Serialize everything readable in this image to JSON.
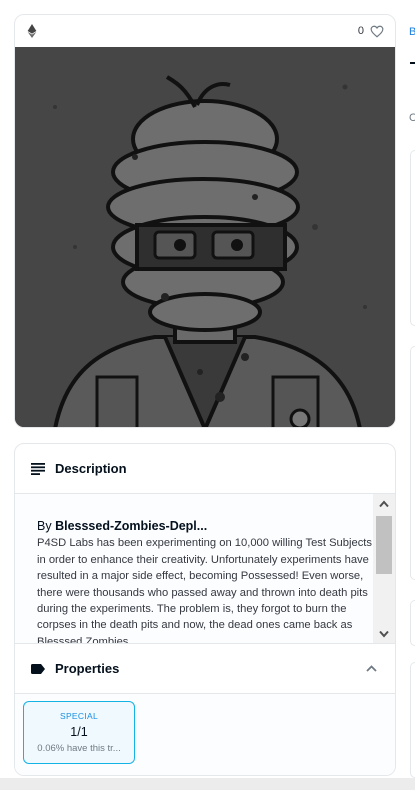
{
  "item": {
    "favorites_count": "0",
    "chain_icon": "ethereum-icon",
    "favorite_icon": "heart-outline-icon",
    "image_alt": "NFT artwork: bandaged mummy zombie wearing glasses and a lab coat"
  },
  "description": {
    "title": "Description",
    "icon": "text-lines-icon",
    "by_prefix": "By",
    "creator": "Blesssed-Zombies-Depl...",
    "body": "P4SD Labs has been experimenting on 10,000 willing Test Subjects in order to enhance their creativity. Unfortunately experiments have resulted in a major side effect, becoming Possessed! Even worse, there were thousands who passed away and thrown into death pits during the experiments. The problem is, they forgot to burn the corpses in the death pits and now, the dead ones came back as Blesssed Zombies..."
  },
  "properties": {
    "title": "Properties",
    "icon": "tag-icon",
    "collapse_icon": "chevron-up-icon",
    "items": [
      {
        "type": "SPECIAL",
        "value": "1/1",
        "rarity": "0.06% have this tr..."
      }
    ]
  },
  "side": {
    "link": "B",
    "letter": "C"
  }
}
